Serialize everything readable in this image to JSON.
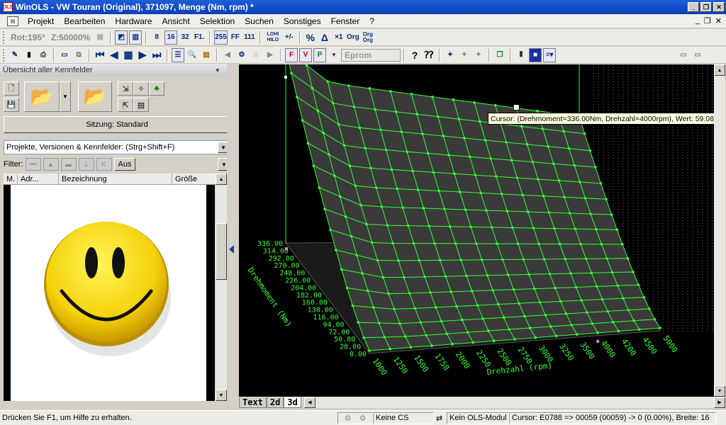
{
  "window": {
    "title": "WinOLS - VW Touran (Original), 371097, Menge (Nm, rpm) *",
    "app_icon": "OLS"
  },
  "menu": {
    "items": [
      "Projekt",
      "Bearbeiten",
      "Hardware",
      "Ansicht",
      "Selektion",
      "Suchen",
      "Sonstiges",
      "Fenster",
      "?"
    ]
  },
  "toolbar1": {
    "rot": "Rot:195°",
    "zoom": "Z:50000%",
    "buttons": [
      "8",
      "16",
      "32",
      "F1.",
      "255",
      "FF",
      "111",
      "LOHI HILO",
      "+/-",
      "%",
      "Δ",
      "×1",
      "Org",
      "Org Org"
    ]
  },
  "toolbar2": {
    "eprom": "Eprom",
    "letter_buttons": [
      "F",
      "V",
      "P"
    ]
  },
  "left_panel": {
    "header": "Übersicht aller Kennfelder",
    "session_button": "Sitzung: Standard",
    "search_combo": "Projekte, Versionen & Kennfelder: (Strg+Shift+F)",
    "filter_label": "Filter:",
    "filter_off": "Aus",
    "columns": [
      "M.",
      "Adr...",
      "Bezeichnung",
      "Größe"
    ]
  },
  "plot": {
    "tooltip": "Cursor: (Drehmoment=336.00Nm, Drehzahl=4000rpm), Wert: 59.08",
    "tabs": [
      "Text",
      "2d",
      "3d"
    ],
    "active_tab": "3d"
  },
  "chart_data": {
    "type": "surface-3d",
    "xlabel": "Drehzahl (rpm)",
    "ylabel": "Drehmoment (Nm)",
    "x": [
      1000,
      1250,
      1500,
      1750,
      2000,
      2250,
      2500,
      2750,
      3000,
      3250,
      3500,
      4000,
      4200,
      4500,
      5000
    ],
    "y": [
      0.0,
      28.0,
      50.0,
      72.0,
      94.0,
      116.0,
      138.0,
      160.0,
      182.0,
      204.0,
      226.0,
      248.0,
      270.0,
      292.0,
      314.0,
      336.0
    ],
    "z_note": "",
    "line_color": "#33ff33",
    "background": "#000000"
  },
  "statusbar": {
    "help": "Drücken Sie F1, um Hilfe zu erhalten.",
    "cs": "Keine CS",
    "ols_module": "Kein OLS-Modul",
    "cursor": "Cursor: E0788 => 00059 (00059) -> 0 (0.00%), Breite: 16"
  }
}
